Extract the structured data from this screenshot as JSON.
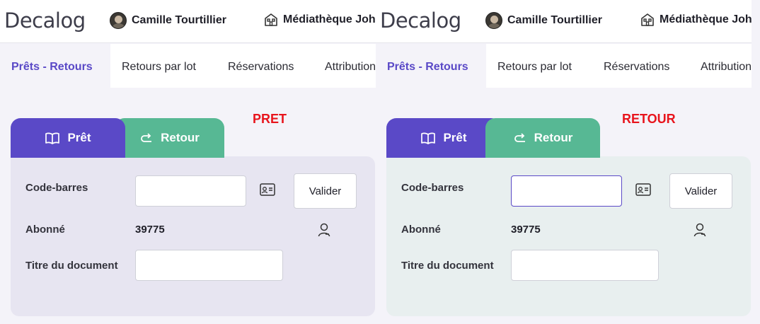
{
  "panels": [
    {
      "logo": "Decalog",
      "user_name": "Camille Tourtillier",
      "library_name": "Médiathèque Johnny",
      "nav_tabs": [
        "Prêts - Retours",
        "Retours par lot",
        "Réservations",
        "Attribution"
      ],
      "annotation": "PRET",
      "mode_tabs": {
        "pret": "Prêt",
        "retour": "Retour"
      },
      "active_mode": "pret",
      "form": {
        "barcode_label": "Code-barres",
        "barcode_value": "",
        "validate_label": "Valider",
        "subscriber_label": "Abonné",
        "subscriber_value": "39775",
        "title_label": "Titre du document",
        "title_value": ""
      }
    },
    {
      "logo": "Decalog",
      "user_name": "Camille Tourtillier",
      "library_name": "Médiathèque Johnny",
      "nav_tabs": [
        "Prêts - Retours",
        "Retours par lot",
        "Réservations",
        "Attribution"
      ],
      "annotation": "RETOUR",
      "mode_tabs": {
        "pret": "Prêt",
        "retour": "Retour"
      },
      "active_mode": "retour",
      "form": {
        "barcode_label": "Code-barres",
        "barcode_value": "",
        "validate_label": "Valider",
        "subscriber_label": "Abonné",
        "subscriber_value": "39775",
        "title_label": "Titre du document",
        "title_value": ""
      }
    }
  ],
  "colors": {
    "accent": "#5a49c7",
    "retour_green": "#57b894",
    "annotation_red": "#e8141c",
    "pret_form_bg": "#e7e5f1",
    "retour_form_bg": "#e8efef"
  },
  "icons": [
    "library-building-icon",
    "book-icon",
    "return-arrow-icon",
    "id-card-icon",
    "user-icon"
  ]
}
